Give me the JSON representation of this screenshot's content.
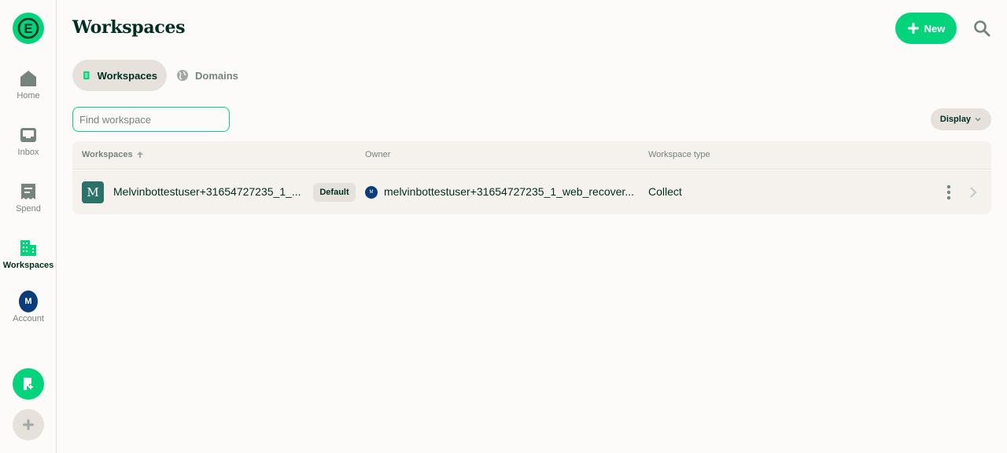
{
  "sidebar": {
    "logo_letter": "E",
    "items": [
      {
        "label": "Home",
        "icon": "home-icon",
        "active": false
      },
      {
        "label": "Inbox",
        "icon": "inbox-icon",
        "active": false
      },
      {
        "label": "Spend",
        "icon": "receipt-icon",
        "active": false
      },
      {
        "label": "Workspaces",
        "icon": "building-icon",
        "active": true
      },
      {
        "label": "Account",
        "icon": "avatar",
        "active": false,
        "avatar_letter": "M"
      }
    ],
    "fab_green_icon": "new-expense-icon",
    "fab_grey_icon": "plus-icon"
  },
  "header": {
    "title": "Workspaces",
    "new_button": "New",
    "search_icon": "search-icon"
  },
  "tabs": [
    {
      "label": "Workspaces",
      "icon": "building-icon",
      "active": true
    },
    {
      "label": "Domains",
      "icon": "globe-icon",
      "active": false
    }
  ],
  "filter": {
    "placeholder": "Find workspace",
    "value": ""
  },
  "display_button": "Display",
  "table": {
    "columns": [
      "Workspaces",
      "Owner",
      "Workspace type"
    ],
    "sort_column": "Workspaces",
    "rows": [
      {
        "avatar_letter": "M",
        "name": "Melvinbottestuser+31654727235_1_...",
        "badge": "Default",
        "owner_avatar_letter": "M",
        "owner": "melvinbottestuser+31654727235_1_web_recover...",
        "type": "Collect"
      }
    ]
  },
  "colors": {
    "accent": "#03d47c",
    "text": "#002e22",
    "muted": "#76847e",
    "background": "#fcfbf9",
    "hover": "#e6e1da",
    "avatar_blue": "#0b3d7a",
    "workspace_avatar": "#2b7268"
  }
}
